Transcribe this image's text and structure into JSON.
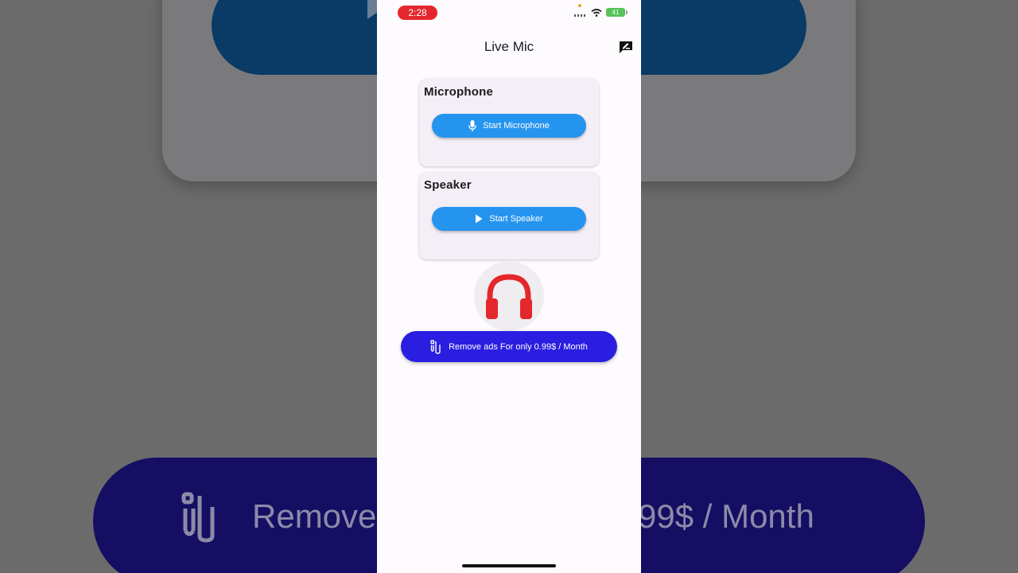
{
  "statusbar": {
    "time": "2:28",
    "battery": "41",
    "icons": [
      "signal-icon",
      "wifi-icon",
      "battery-icon"
    ]
  },
  "appbar": {
    "title": "Live Mic",
    "action_icon": "feedback-icon"
  },
  "microphone_card": {
    "title": "Microphone",
    "button_label": "Start Microphone",
    "button_icon": "mic-icon"
  },
  "speaker_card": {
    "title": "Speaker",
    "button_label": "Start Speaker",
    "button_icon": "play-icon"
  },
  "center_icon": "headphones-icon",
  "remove_ads": {
    "label": "Remove ads For only 0.99$ / Month",
    "icon": "remove-ads-icon"
  },
  "background": {
    "big_text_left": "Remove",
    "big_text_right": "99$ / Month"
  },
  "colors": {
    "primary_button": "#2594ee",
    "remove_ads_button": "#2a1ee0",
    "headphones": "#e4272c",
    "time_pill": "#e4272c",
    "card": "#f4eff7"
  }
}
